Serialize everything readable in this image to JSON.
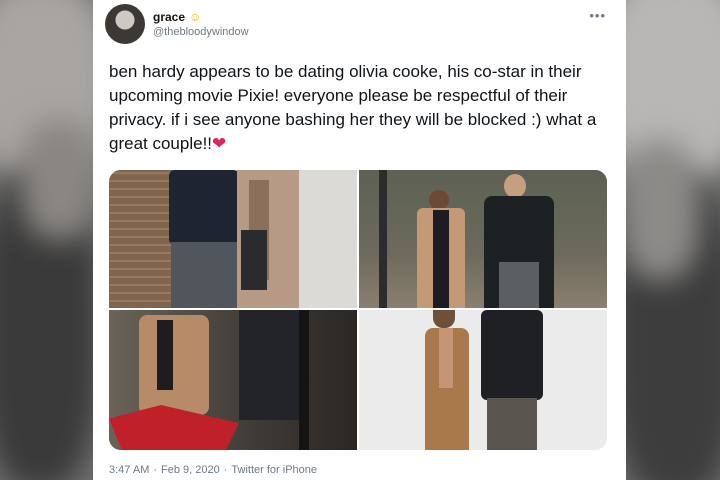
{
  "tweet": {
    "author": {
      "display_name": "grace",
      "emoji": "☺",
      "handle": "@thebloodywindow"
    },
    "more_icon": "•••",
    "text": "ben hardy appears to be dating olivia cooke, his co-star in their upcoming movie Pixie! everyone please be respectful of their privacy. if i see anyone bashing her they will be blocked :) what a great couple!!",
    "text_emoji": "❤",
    "photos": 4,
    "footer": {
      "time": "3:47 AM",
      "separator": "·",
      "date": "Feb 9, 2020",
      "source": "Twitter for iPhone"
    }
  }
}
